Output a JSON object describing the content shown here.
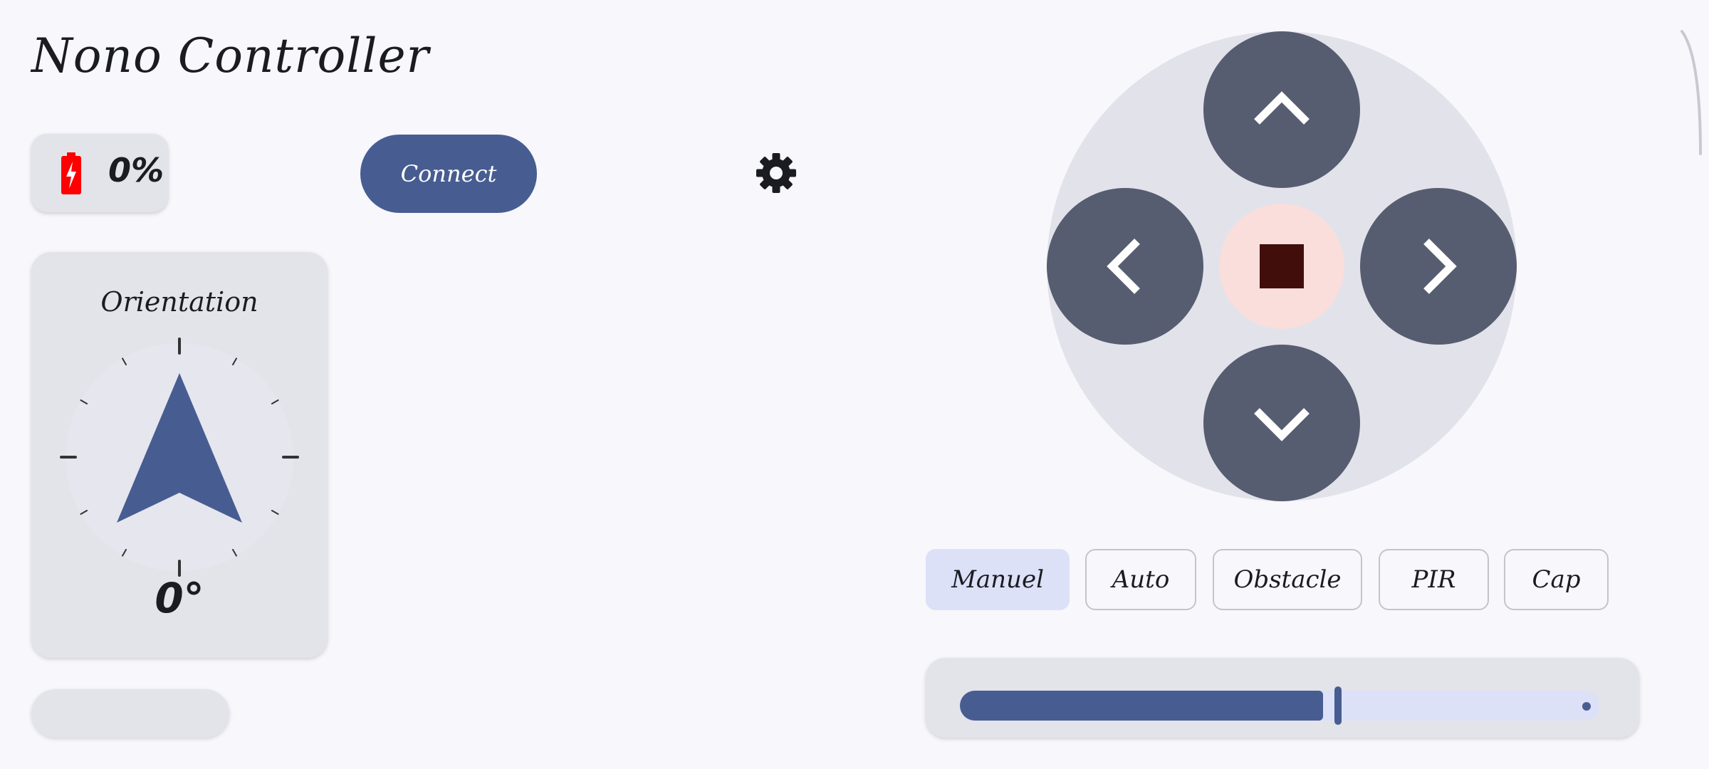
{
  "app": {
    "title": "Nono Controller"
  },
  "battery": {
    "value": "0%",
    "icon": "battery-charging-icon",
    "icon_color": "#ff0000"
  },
  "connect": {
    "label": "Connect"
  },
  "settings": {
    "icon": "gear-icon"
  },
  "orientation": {
    "title": "Orientation",
    "value": "0°",
    "heading_degrees": 0
  },
  "dpad": {
    "up_icon": "chevron-up-icon",
    "down_icon": "chevron-down-icon",
    "left_icon": "chevron-left-icon",
    "right_icon": "chevron-right-icon",
    "stop_icon": "stop-icon"
  },
  "modes": {
    "selected": "Manuel",
    "items": [
      "Manuel",
      "Auto",
      "Obstacle",
      "PIR",
      "Cap"
    ]
  },
  "speed_slider": {
    "fraction": 0.57
  },
  "colors": {
    "primary": "#475d92",
    "dpad_button": "#575d70",
    "stop_background": "#f9dedc",
    "stop_icon": "#410e0b",
    "selected_chip": "#dce1f8",
    "background": "#f7f7fc",
    "card": "#e3e3ea"
  }
}
